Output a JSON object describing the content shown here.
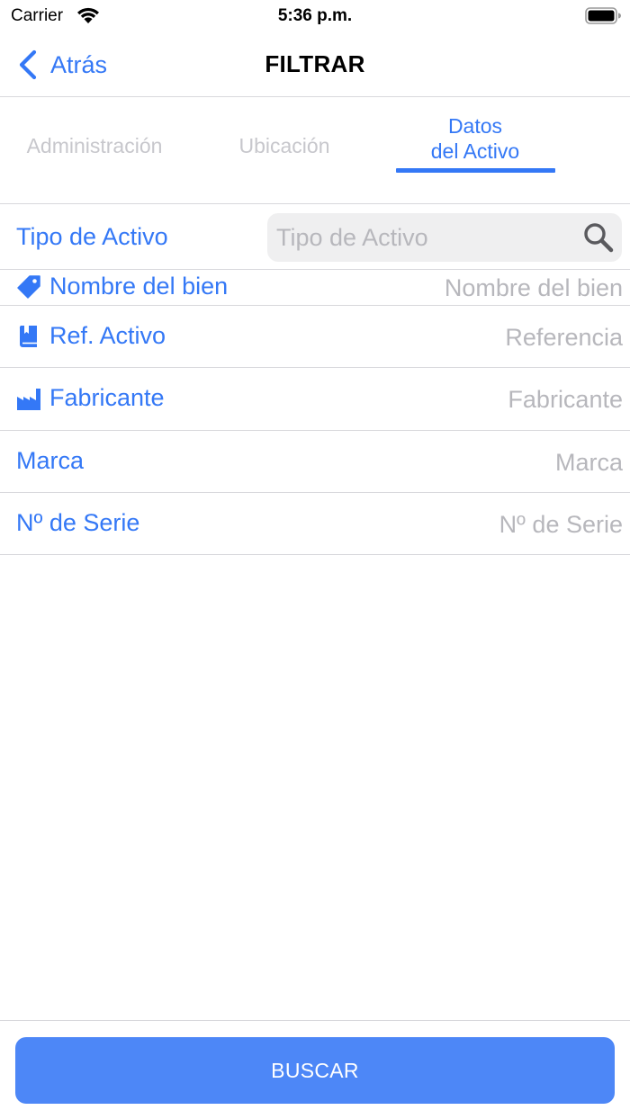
{
  "status_bar": {
    "carrier": "Carrier",
    "time": "5:36 p.m.",
    "icons": [
      "wifi-icon",
      "battery-icon"
    ]
  },
  "nav": {
    "back_label": "Atrás",
    "title": "FILTRAR"
  },
  "tabs": [
    {
      "label": "Administración",
      "active": false
    },
    {
      "label": "Ubicación",
      "active": false
    },
    {
      "label": "Datos\ndel Activo",
      "active": true
    }
  ],
  "form": {
    "tipo_activo": {
      "label": "Tipo de Activo",
      "placeholder": "Tipo de Activo",
      "icon": "search-icon"
    },
    "nombre_bien": {
      "label": "Nombre del bien",
      "placeholder": "Nombre del bien",
      "icon": "tag-icon"
    },
    "ref_activo": {
      "label": "Ref. Activo",
      "placeholder": "Referencia",
      "icon": "book-icon"
    },
    "fabricante": {
      "label": "Fabricante",
      "placeholder": "Fabricante",
      "icon": "factory-icon"
    },
    "marca": {
      "label": "Marca",
      "placeholder": "Marca"
    },
    "serie": {
      "label": "Nº de Serie",
      "placeholder": "Nº de Serie"
    }
  },
  "search_button": {
    "label": "BUSCAR"
  },
  "colors": {
    "accent": "#3478f6",
    "button": "#4d87f7",
    "placeholder": "#b7b7bc",
    "inactive_tab": "#c7c7cc",
    "separator": "#d8d8dc"
  }
}
